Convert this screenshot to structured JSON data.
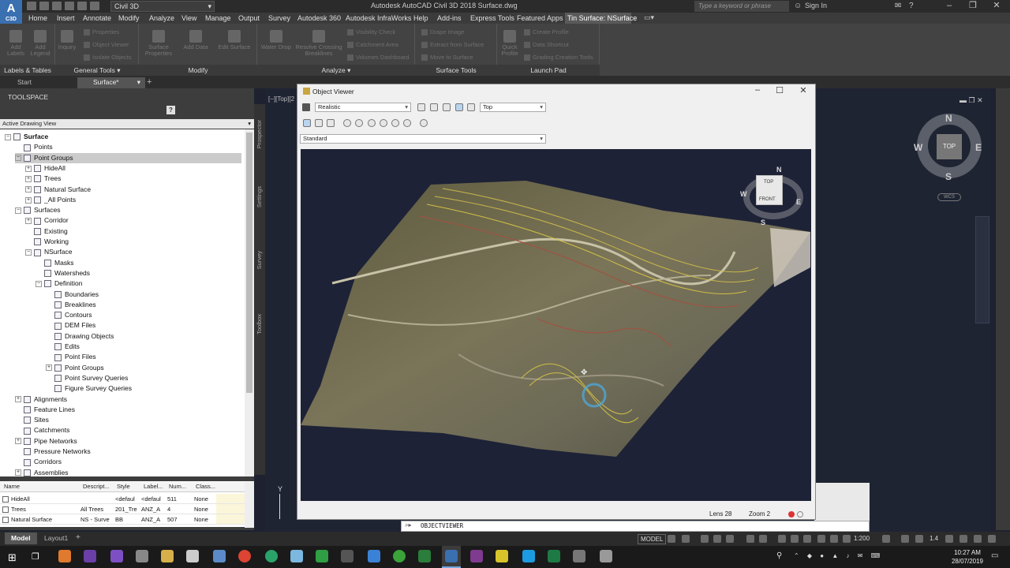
{
  "window": {
    "app_title": "Autodesk AutoCAD Civil 3D 2018    Surface.dwg",
    "workspace": "Civil 3D",
    "search_placeholder": "Type a keyword or phrase",
    "sign_in": "Sign In",
    "logo_text": "A",
    "logo_sub": "C3D"
  },
  "menu": [
    "Home",
    "Insert",
    "Annotate",
    "Modify",
    "Analyze",
    "View",
    "Manage",
    "Output",
    "Survey",
    "Autodesk 360",
    "Autodesk InfraWorks",
    "Help",
    "Add-ins",
    "Express Tools",
    "Featured Apps",
    "Tin Surface: NSurface"
  ],
  "ribbon": {
    "labels_tables": {
      "add_labels": "Add Labels",
      "add_legend": "Add Legend"
    },
    "general_tools": {
      "inquiry": "Inquiry",
      "properties": "Properties",
      "object_viewer": "Object Viewer",
      "isolate_objects": "Isolate Objects"
    },
    "modify": {
      "surface_properties": "Surface Properties",
      "add_data": "Add Data",
      "edit_surface": "Edit Surface"
    },
    "analyze": {
      "water_drop": "Water Drop",
      "resolve_crossing": "Resolve Crossing Breaklines",
      "visibility_check": "Visibility Check",
      "catchment_area": "Catchment Area",
      "volumes_dashboard": "Volumes Dashboard"
    },
    "surface_tools": {
      "drape_image": "Drape Image",
      "extract_from_surface": "Extract from Surface",
      "move_to_surface": "Move to Surface"
    },
    "launch_pad": {
      "quick_profile": "Quick Profile",
      "create_profile": "Create Profile",
      "data_shortcut": "Data Shortcut",
      "grading_creation_tools": "Grading Creation Tools"
    },
    "group_labels": [
      "Labels & Tables",
      "General Tools",
      "Modify",
      "Analyze",
      "Surface Tools",
      "Launch Pad"
    ]
  },
  "file_tabs": [
    "Start",
    "Surface*"
  ],
  "toolspace": {
    "title": "TOOLSPACE",
    "view": "Active Drawing View",
    "vtabs": [
      "Prospector",
      "Settings",
      "Survey",
      "Toolbox"
    ],
    "tree": [
      {
        "label": "Surface",
        "level": 0,
        "bold": true,
        "tw": "−"
      },
      {
        "label": "Points",
        "level": 1,
        "tw": ""
      },
      {
        "label": "Point Groups",
        "level": 1,
        "tw": "−",
        "selected": true
      },
      {
        "label": "HideAll",
        "level": 2,
        "tw": "+"
      },
      {
        "label": "Trees",
        "level": 2,
        "tw": "+"
      },
      {
        "label": "Natural Surface",
        "level": 2,
        "tw": "+"
      },
      {
        "label": "_All Points",
        "level": 2,
        "tw": "+"
      },
      {
        "label": "Surfaces",
        "level": 1,
        "tw": "−"
      },
      {
        "label": "Corridor",
        "level": 2,
        "tw": "+"
      },
      {
        "label": "Existing",
        "level": 2,
        "tw": ""
      },
      {
        "label": "Working",
        "level": 2,
        "tw": ""
      },
      {
        "label": "NSurface",
        "level": 2,
        "tw": "−"
      },
      {
        "label": "Masks",
        "level": 3,
        "tw": ""
      },
      {
        "label": "Watersheds",
        "level": 3,
        "tw": ""
      },
      {
        "label": "Definition",
        "level": 3,
        "tw": "−"
      },
      {
        "label": "Boundaries",
        "level": 4,
        "tw": ""
      },
      {
        "label": "Breaklines",
        "level": 4,
        "tw": ""
      },
      {
        "label": "Contours",
        "level": 4,
        "tw": ""
      },
      {
        "label": "DEM Files",
        "level": 4,
        "tw": ""
      },
      {
        "label": "Drawing Objects",
        "level": 4,
        "tw": ""
      },
      {
        "label": "Edits",
        "level": 4,
        "tw": ""
      },
      {
        "label": "Point Files",
        "level": 4,
        "tw": ""
      },
      {
        "label": "Point Groups",
        "level": 4,
        "tw": "+"
      },
      {
        "label": "Point Survey Queries",
        "level": 4,
        "tw": ""
      },
      {
        "label": "Figure Survey Queries",
        "level": 4,
        "tw": ""
      },
      {
        "label": "Alignments",
        "level": 1,
        "tw": "+"
      },
      {
        "label": "Feature Lines",
        "level": 1,
        "tw": ""
      },
      {
        "label": "Sites",
        "level": 1,
        "tw": ""
      },
      {
        "label": "Catchments",
        "level": 1,
        "tw": ""
      },
      {
        "label": "Pipe Networks",
        "level": 1,
        "tw": "+"
      },
      {
        "label": "Pressure Networks",
        "level": 1,
        "tw": ""
      },
      {
        "label": "Corridors",
        "level": 1,
        "tw": ""
      },
      {
        "label": "Assemblies",
        "level": 1,
        "tw": "+"
      }
    ]
  },
  "item_list": {
    "columns": [
      "Name",
      "Descript...",
      "Style",
      "Label...",
      "Num...",
      "Class..."
    ],
    "rows": [
      [
        "HideAll",
        "",
        "<defaul",
        "<defaul",
        "511",
        "None"
      ],
      [
        "Trees",
        "All Trees",
        "201_Tre",
        "ANZ_A",
        "4",
        "None"
      ],
      [
        "Natural Surface",
        "NS - Surve",
        "BB",
        "ANZ_A",
        "507",
        "None"
      ]
    ]
  },
  "viewport": {
    "label": "[−][Top][2",
    "compass": {
      "n": "N",
      "s": "S",
      "e": "E",
      "w": "W",
      "top": "TOP",
      "wcs": "WCS"
    },
    "ucs_y": "Y"
  },
  "object_viewer": {
    "title": "Object Viewer",
    "visual_style": "Realistic",
    "view": "Top",
    "style": "Standard",
    "cube": {
      "top": "TOP",
      "front": "FRONT",
      "n": "N",
      "s": "S",
      "e": "E",
      "w": "W"
    },
    "lens": "Lens 28",
    "zoom": "Zoom 2"
  },
  "command": "OBJECTVIEWER",
  "status": {
    "tabs": [
      "Model",
      "Layout1"
    ],
    "model": "MODEL",
    "scale": "1:200",
    "lineweight": "1.4"
  },
  "clock": {
    "time": "10:27 AM",
    "date": "28/07/2019"
  },
  "colors": {
    "accent_blue": "#3a6fb0",
    "ribbon_bg": "#434343",
    "drawing_bg": "#1f2433"
  }
}
